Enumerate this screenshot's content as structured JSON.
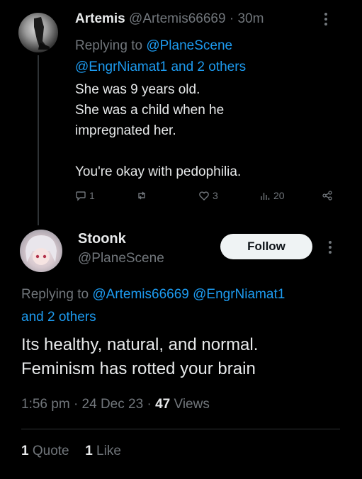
{
  "tweet1": {
    "name": "Artemis",
    "handle": "@Artemis66669",
    "time": "30m",
    "replying_prefix": "Replying to ",
    "replying_mention1": "@PlaneScene",
    "replying_line2": "@EngrNiamat1 and 2 others",
    "body_lines": [
      "She was 9 years old.",
      "She was a child when he",
      "impregnated her.",
      "",
      "You're okay with pedophilia."
    ],
    "replies": "1",
    "retweets": "",
    "likes": "3",
    "views": "20"
  },
  "tweet2": {
    "name": "Stoonk",
    "handle": "@PlaneScene",
    "follow_label": "Follow",
    "replying_prefix": "Replying to ",
    "replying_mentions": "@Artemis66669 @EngrNiamat1",
    "replying_line2": "and 2 others",
    "body_line1": "Its healthy, natural, and normal.",
    "body_line2": "Feminism has rotted your brain",
    "time": "1:56 pm",
    "date": "24 Dec 23",
    "views_count": "47",
    "views_label": "Views",
    "quotes_count": "1",
    "quotes_label": "Quote",
    "likes_count": "1",
    "likes_label": "Like"
  },
  "colors": {
    "accent": "#1d9bf0",
    "muted": "#71767b",
    "text": "#e7e9ea",
    "bg": "#000000"
  },
  "icons": [
    "reply-icon",
    "retweet-icon",
    "like-icon",
    "views-icon",
    "share-icon",
    "more-icon"
  ]
}
